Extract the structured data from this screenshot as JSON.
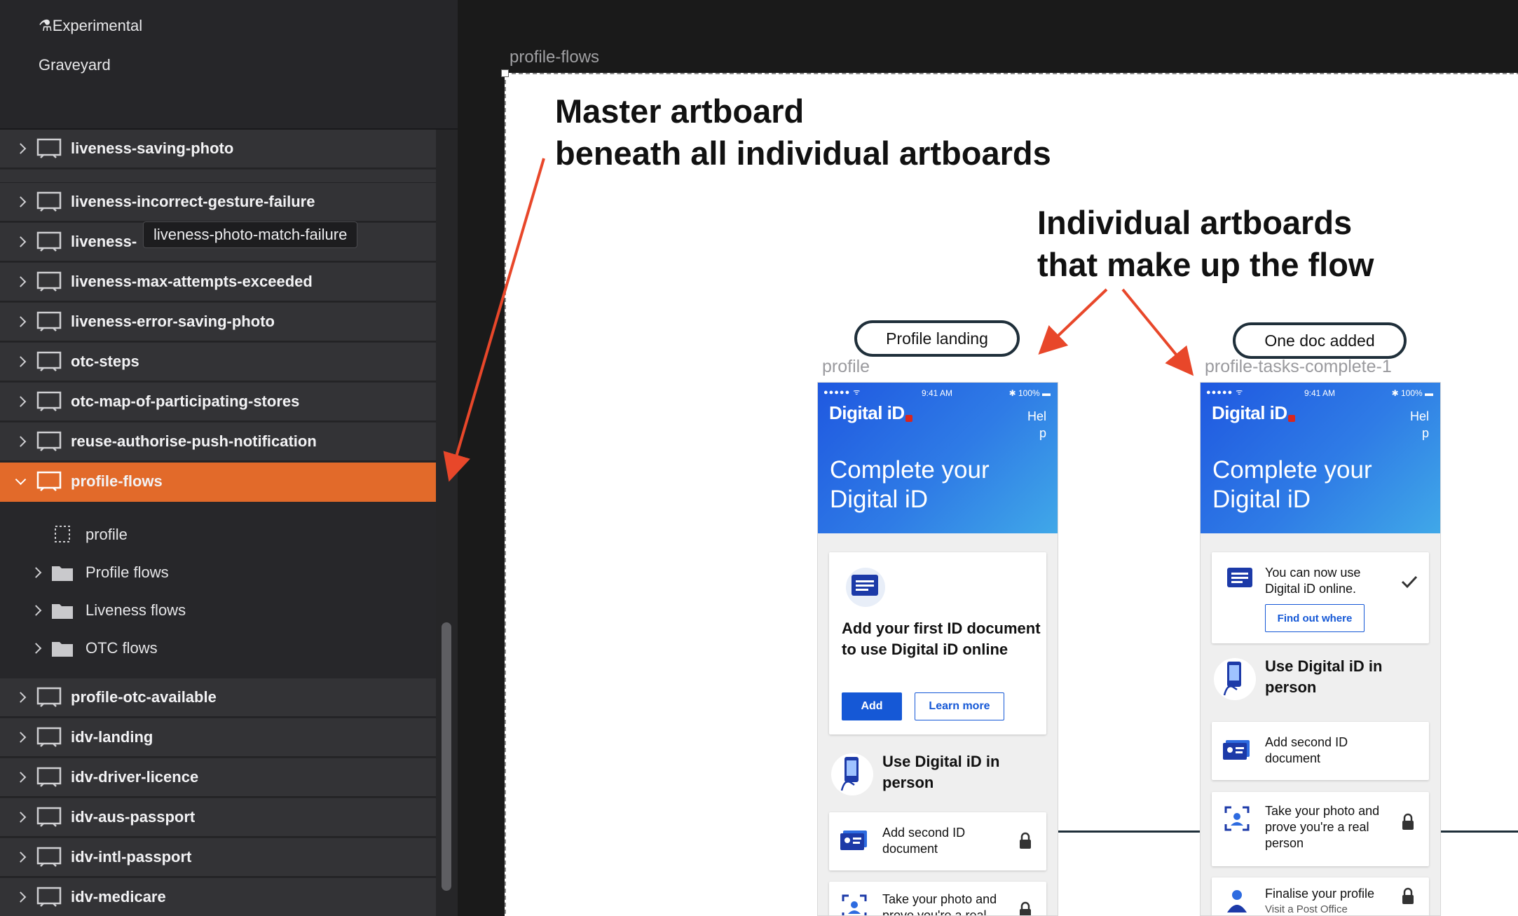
{
  "sidebar": {
    "pages": [
      {
        "label": "⚗Experimental"
      },
      {
        "label": "Graveyard"
      }
    ],
    "layers": [
      {
        "label": "liveness-saving-photo",
        "state": "collapsed"
      },
      {
        "label": "liveness-incorrect-gesture-failure",
        "state": "collapsed"
      },
      {
        "label": "liveness-photo-match-failure",
        "state": "collapsed"
      },
      {
        "label": "liveness-max-attempts-exceeded",
        "state": "collapsed"
      },
      {
        "label": "liveness-error-saving-photo",
        "state": "collapsed"
      },
      {
        "label": "otc-steps",
        "state": "collapsed"
      },
      {
        "label": "otc-map-of-participating-stores",
        "state": "collapsed"
      },
      {
        "label": "reuse-authorise-push-notification",
        "state": "collapsed"
      },
      {
        "label": "profile-flows",
        "state": "expanded-selected"
      }
    ],
    "children": [
      {
        "label": "profile",
        "type": "artboard"
      },
      {
        "label": "Profile flows",
        "type": "folder"
      },
      {
        "label": "Liveness flows",
        "type": "folder"
      },
      {
        "label": "OTC flows",
        "type": "folder"
      }
    ],
    "layers_after": [
      {
        "label": "profile-otc-available"
      },
      {
        "label": "idv-landing"
      },
      {
        "label": "idv-driver-licence"
      },
      {
        "label": "idv-aus-passport"
      },
      {
        "label": "idv-intl-passport"
      },
      {
        "label": "idv-medicare"
      }
    ],
    "tooltip": "liveness-photo-match-failure",
    "tooltip_row_clipped_prefix": "liveness-",
    "accent": "#e26a2a"
  },
  "canvas": {
    "master_name": "profile-flows",
    "notes": {
      "master_line1": "Master artboard",
      "master_line2": "beneath all individual artboards",
      "individual_line1": "Individual artboards",
      "individual_line2": "that make up the flow"
    },
    "arrow_color": "#e8472a",
    "screens": [
      {
        "pill": "Profile landing",
        "name": "profile",
        "status": {
          "dots": "●●●●● ᯤ",
          "time": "9:41 AM",
          "battery": "✱ 100% ▬"
        },
        "logo": "Digital iD",
        "help": "Help",
        "title": "Complete your Digital iD",
        "card": {
          "text": "Add your first ID document to use Digital iD online",
          "primary": "Add",
          "secondary": "Learn more"
        },
        "section": "Use Digital iD in person",
        "rows": [
          {
            "text": "Add second ID document",
            "locked": true
          },
          {
            "text": "Take your photo and prove you're a real person",
            "locked": true
          }
        ]
      },
      {
        "pill": "One doc added",
        "name": "profile-tasks-complete-1",
        "status": {
          "dots": "●●●●● ᯤ",
          "time": "9:41 AM",
          "battery": "✱ 100% ▬"
        },
        "logo": "Digital iD",
        "help": "Help",
        "title": "Complete your Digital iD",
        "card": {
          "text": "You can now use Digital iD online.",
          "link": "Find out where"
        },
        "section": "Use Digital iD in person",
        "rows": [
          {
            "text": "Add second ID document",
            "locked": false
          },
          {
            "text": "Take your photo and prove you're a real person",
            "locked": true
          },
          {
            "text": "Finalise your profile",
            "sub": "Visit a Post Office",
            "locked": true
          }
        ]
      }
    ]
  }
}
